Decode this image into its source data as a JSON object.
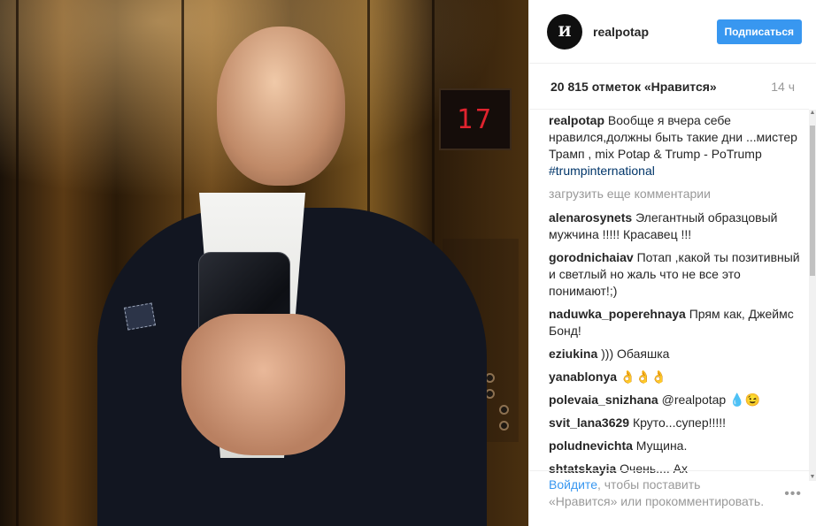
{
  "photo": {
    "floor_display": "17"
  },
  "header": {
    "username": "realpotap",
    "follow_label": "Подписаться",
    "avatar_text": "И"
  },
  "stats": {
    "likes": "20 815 отметок «Нравится»",
    "time": "14 ч"
  },
  "caption": {
    "user": "realpotap",
    "text": "Вообще я вчера себе нравился,должны быть такие дни ...мистер Трамп , mix Potap & Trump - PoTrump",
    "hashtag": "#trumpinternational"
  },
  "load_more": "загрузить еще комментарии",
  "comments": [
    {
      "user": "alenarosynets",
      "text": "Элегантный образцовый мужчина !!!!! Красавец !!!"
    },
    {
      "user": "gorodnichaiav",
      "text": "Потап ,какой ты позитивный и светлый но жаль что не все это понимают!;)"
    },
    {
      "user": "naduwka_poperehnaya",
      "text": "Прям как, Джеймс Бонд!"
    },
    {
      "user": "eziukina",
      "text": ")))  Обаяшка"
    },
    {
      "user": "yanablonya",
      "text": "👌👌👌"
    },
    {
      "user": "polevaia_snizhana",
      "text": "@realpotap 💧😉"
    },
    {
      "user": "svit_lana3629",
      "text": "Круто...супер!!!!!"
    },
    {
      "user": "poludnevichta",
      "text": "Мущина."
    },
    {
      "user": "shtatskayia",
      "text": "Очень.... Ах"
    }
  ],
  "footer": {
    "login_link": "Войдите",
    "text": ", чтобы поставить «Нравится» или прокомментировать.",
    "more_icon": "ellipsis-icon"
  }
}
